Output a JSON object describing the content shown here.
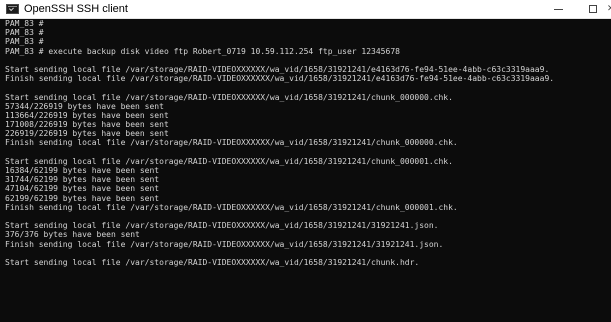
{
  "window": {
    "title": "OpenSSH SSH client",
    "icon": "terminal-icon"
  },
  "controls": {
    "minimize_icon": "minimize-icon",
    "maximize_icon": "maximize-icon",
    "close_icon": "close-icon"
  },
  "colors": {
    "terminal_background": "#0c0c0c",
    "terminal_text": "#d4d4d4",
    "titlebar_background": "#ffffff"
  },
  "terminal": {
    "lines": [
      "PAM_83 #",
      "PAM_83 #",
      "PAM_83 #",
      "PAM_83 # execute backup disk video ftp Robert_0719 10.59.112.254 ftp_user 12345678",
      "",
      "Start sending local file /var/storage/RAID-VIDEOXXXXXX/wa_vid/1658/31921241/e4163d76-fe94-51ee-4abb-c63c3319aaa9.",
      "Finish sending local file /var/storage/RAID-VIDEOXXXXXX/wa_vid/1658/31921241/e4163d76-fe94-51ee-4abb-c63c3319aaa9.",
      "",
      "Start sending local file /var/storage/RAID-VIDEOXXXXXX/wa_vid/1658/31921241/chunk_000000.chk.",
      "57344/226919 bytes have been sent",
      "113664/226919 bytes have been sent",
      "171008/226919 bytes have been sent",
      "226919/226919 bytes have been sent",
      "Finish sending local file /var/storage/RAID-VIDEOXXXXXX/wa_vid/1658/31921241/chunk_000000.chk.",
      "",
      "Start sending local file /var/storage/RAID-VIDEOXXXXXX/wa_vid/1658/31921241/chunk_000001.chk.",
      "16384/62199 bytes have been sent",
      "31744/62199 bytes have been sent",
      "47104/62199 bytes have been sent",
      "62199/62199 bytes have been sent",
      "Finish sending local file /var/storage/RAID-VIDEOXXXXXX/wa_vid/1658/31921241/chunk_000001.chk.",
      "",
      "Start sending local file /var/storage/RAID-VIDEOXXXXXX/wa_vid/1658/31921241/31921241.json.",
      "376/376 bytes have been sent",
      "Finish sending local file /var/storage/RAID-VIDEOXXXXXX/wa_vid/1658/31921241/31921241.json.",
      "",
      "Start sending local file /var/storage/RAID-VIDEOXXXXXX/wa_vid/1658/31921241/chunk.hdr."
    ]
  }
}
